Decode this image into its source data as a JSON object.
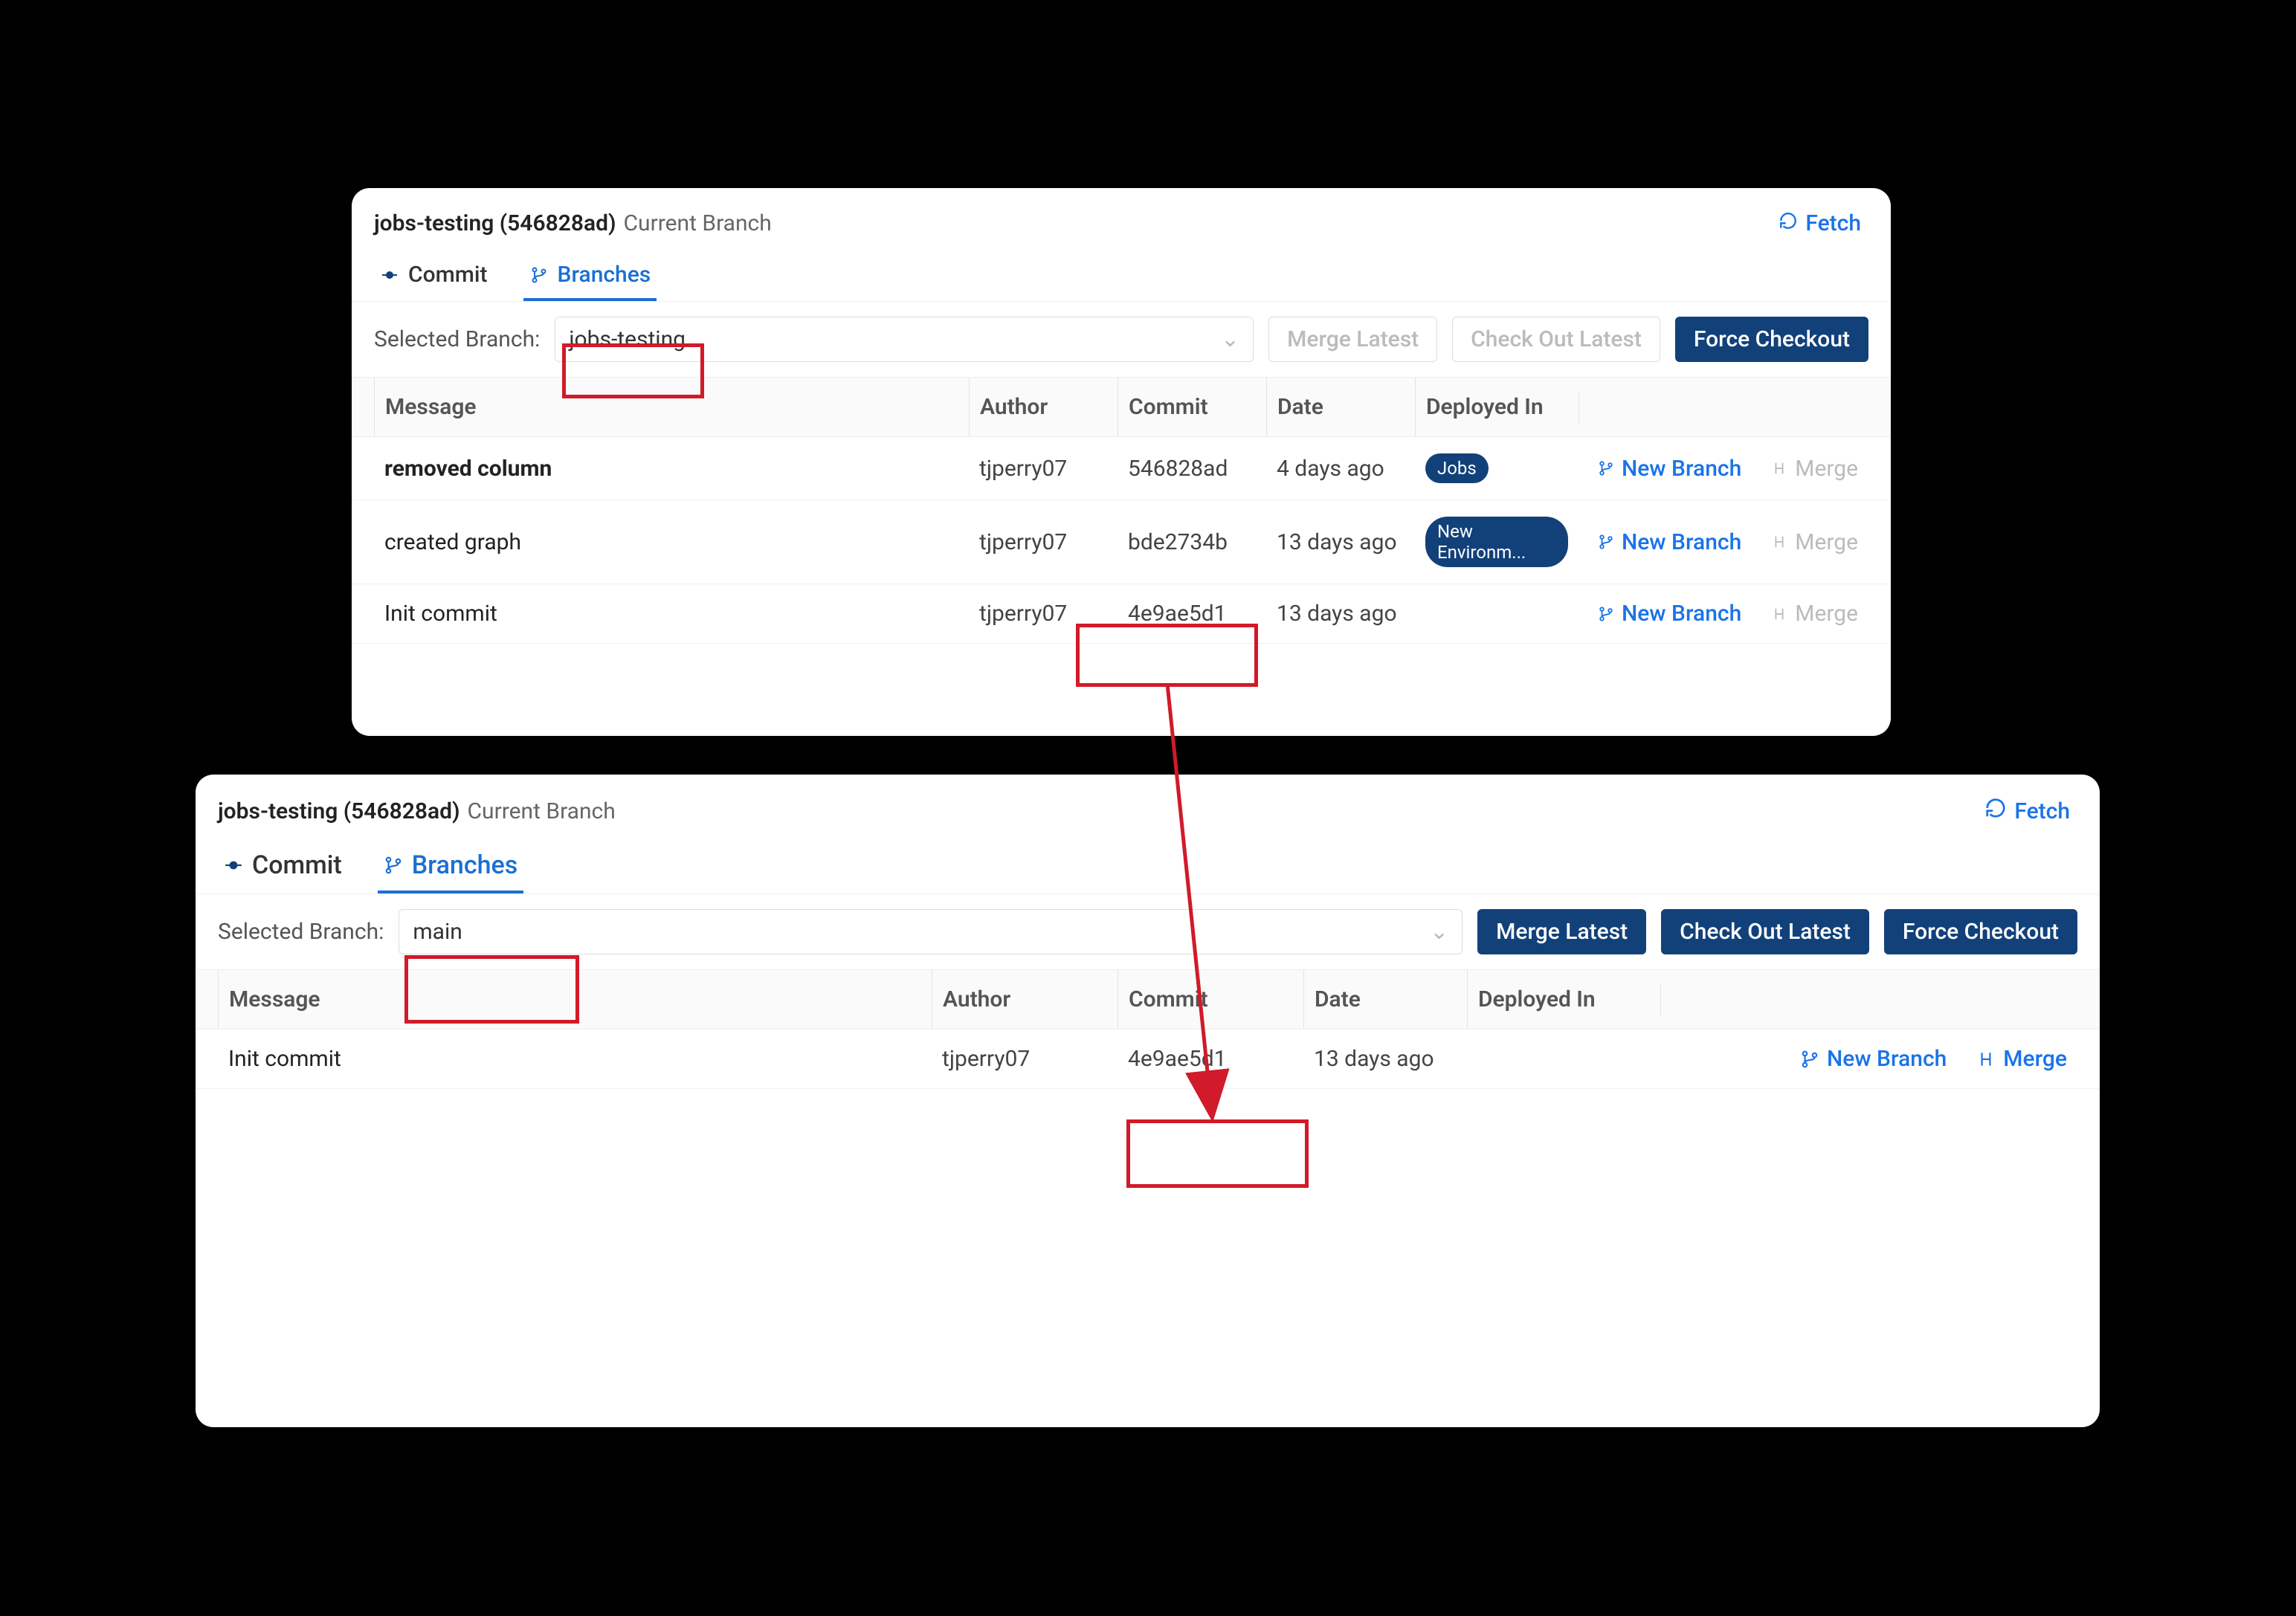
{
  "panelTop": {
    "title_bold": "jobs-testing (546828ad)",
    "title_light": "Current Branch",
    "fetch_label": "Fetch",
    "tabs": {
      "commit": "Commit",
      "branches": "Branches"
    },
    "select_label": "Selected Branch:",
    "select_value": "jobs-testing",
    "buttons": {
      "merge_latest": "Merge Latest",
      "checkout_latest": "Check Out Latest",
      "force_checkout": "Force Checkout"
    },
    "columns": {
      "message": "Message",
      "author": "Author",
      "commit": "Commit",
      "date": "Date",
      "deployed": "Deployed In"
    },
    "rows": [
      {
        "message": "removed column",
        "author": "tjperry07",
        "commit": "546828ad",
        "date": "4 days ago",
        "badge": "Jobs",
        "new_branch": "New Branch",
        "merge": "Merge",
        "current": true
      },
      {
        "message": "created graph",
        "author": "tjperry07",
        "commit": "bde2734b",
        "date": "13 days ago",
        "badge": "New Environm...",
        "new_branch": "New Branch",
        "merge": "Merge"
      },
      {
        "message": "Init commit",
        "author": "tjperry07",
        "commit": "4e9ae5d1",
        "date": "13 days ago",
        "badge": "",
        "new_branch": "New Branch",
        "merge": "Merge"
      }
    ]
  },
  "panelBottom": {
    "title_bold": "jobs-testing (546828ad)",
    "title_light": "Current Branch",
    "fetch_label": "Fetch",
    "tabs": {
      "commit": "Commit",
      "branches": "Branches"
    },
    "select_label": "Selected Branch:",
    "select_value": "main",
    "buttons": {
      "merge_latest": "Merge Latest",
      "checkout_latest": "Check Out Latest",
      "force_checkout": "Force Checkout"
    },
    "columns": {
      "message": "Message",
      "author": "Author",
      "commit": "Commit",
      "date": "Date",
      "deployed": "Deployed In"
    },
    "rows": [
      {
        "message": "Init commit",
        "author": "tjperry07",
        "commit": "4e9ae5d1",
        "date": "13 days ago",
        "new_branch": "New Branch",
        "merge": "Merge"
      }
    ]
  },
  "annotations": {
    "highlight_color": "#d11a2a"
  }
}
